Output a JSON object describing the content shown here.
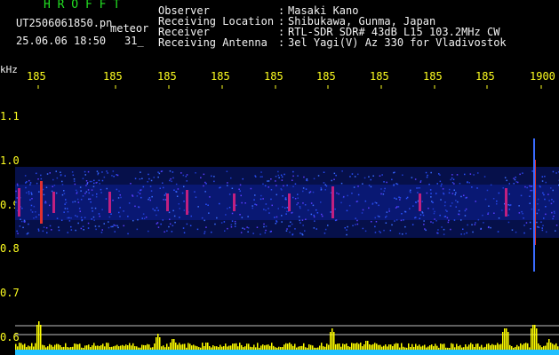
{
  "header": {
    "logo": "H R O F F T",
    "filename": "UT2506061850.pn",
    "type_label": "meteor",
    "datetime": "25.06.06 18:50",
    "count": "31_"
  },
  "info": {
    "labels": "Observer\nReceiving Location\nReceiver\nReceiving Antenna",
    "colons": ":\n:\n:\n:",
    "values": "Masaki Kano\nShibukawa, Gunma, Japan\nRTL-SDR SDR# 43dB L15 103.2MHz CW\n3el Yagi(V) Az 330 for Vladivostok"
  },
  "axes": {
    "y_unit": "kHz",
    "x_ticks": [
      "185",
      "185",
      "185",
      "185",
      "185",
      "185",
      "185",
      "185",
      "185",
      "1900"
    ],
    "y_ticks": [
      "1.1",
      "1.0",
      "0.9",
      "0.8",
      "0.7",
      "0.6"
    ]
  },
  "colors": {
    "label": "#f2f2f2",
    "axis": "#ffff20",
    "logo": "#22e022",
    "noise_band": "#0a1a7a",
    "meteor": "#e03030",
    "activity": "#ffff00",
    "baseline": "#20c0ff"
  }
}
